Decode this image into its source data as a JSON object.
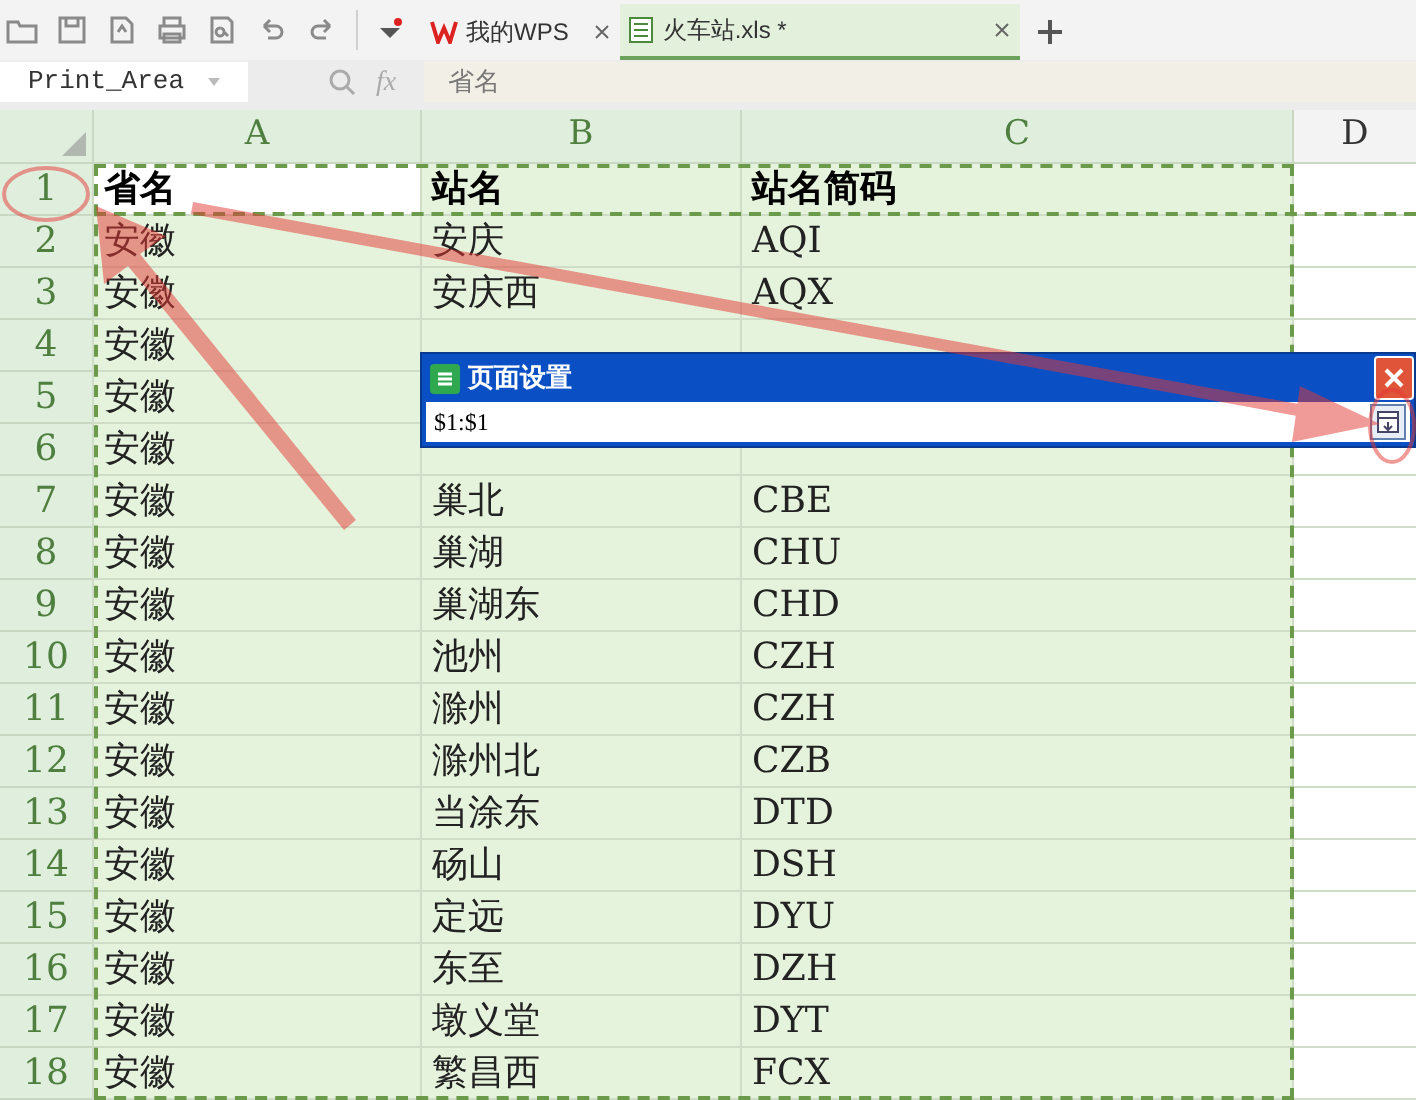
{
  "toolbar": {
    "tabs": [
      {
        "label": "我的WPS",
        "selected": false
      },
      {
        "label": "火车站.xls *",
        "selected": true
      }
    ]
  },
  "formula_bar": {
    "name_box": "Print_Area",
    "fx": "fx",
    "formula": "省名"
  },
  "columns": [
    "A",
    "B",
    "C",
    "D"
  ],
  "rows": [
    {
      "number": "1",
      "kind": "header",
      "cells": [
        "省名",
        "站名",
        "站名简码"
      ]
    },
    {
      "number": "2",
      "kind": "data",
      "cells": [
        "安徽",
        "安庆",
        "AQI"
      ]
    },
    {
      "number": "3",
      "kind": "data",
      "cells": [
        "安徽",
        "安庆西",
        "AQX"
      ]
    },
    {
      "number": "4",
      "kind": "data",
      "cells": [
        "安徽"
      ]
    },
    {
      "number": "5",
      "kind": "data",
      "cells": [
        "安徽"
      ]
    },
    {
      "number": "6",
      "kind": "data",
      "cells": [
        "安徽"
      ]
    },
    {
      "number": "7",
      "kind": "data",
      "cells": [
        "安徽",
        "巢北",
        "CBE"
      ]
    },
    {
      "number": "8",
      "kind": "data",
      "cells": [
        "安徽",
        "巢湖",
        "CHU"
      ]
    },
    {
      "number": "9",
      "kind": "data",
      "cells": [
        "安徽",
        "巢湖东",
        "CHD"
      ]
    },
    {
      "number": "10",
      "kind": "data",
      "cells": [
        "安徽",
        "池州",
        "CZH"
      ]
    },
    {
      "number": "11",
      "kind": "data",
      "cells": [
        "安徽",
        "滁州",
        "CZH"
      ]
    },
    {
      "number": "12",
      "kind": "data",
      "cells": [
        "安徽",
        "滁州北",
        "CZB"
      ]
    },
    {
      "number": "13",
      "kind": "data",
      "cells": [
        "安徽",
        "当涂东",
        "DTD"
      ]
    },
    {
      "number": "14",
      "kind": "data",
      "cells": [
        "安徽",
        "砀山",
        "DSH"
      ]
    },
    {
      "number": "15",
      "kind": "data",
      "cells": [
        "安徽",
        "定远",
        "DYU"
      ]
    },
    {
      "number": "16",
      "kind": "data",
      "cells": [
        "安徽",
        "东至",
        "DZH"
      ]
    },
    {
      "number": "17",
      "kind": "data",
      "cells": [
        "安徽",
        "墩义堂",
        "DYT"
      ]
    },
    {
      "number": "18",
      "kind": "data",
      "cells": [
        "安徽",
        "繁昌西",
        "FCX"
      ]
    }
  ],
  "dialog": {
    "title": "页面设置",
    "value": "$1:$1"
  }
}
